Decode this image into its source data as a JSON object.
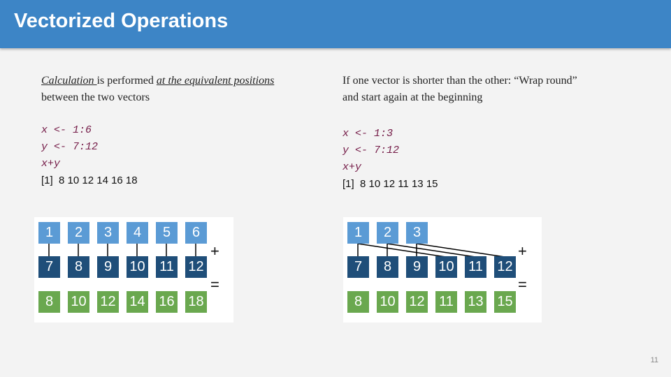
{
  "header": {
    "title": "Vectorized Operations"
  },
  "left": {
    "desc": {
      "u1": "Calculation ",
      "t1": "is performed  ",
      "u2": "at the equivalent positions",
      "t2": " between the two vectors"
    },
    "code": [
      "x <- 1:6",
      "y <- 7:12",
      "x+y"
    ],
    "output": "[1]  8 10 12 14 16 18",
    "diagram": {
      "top": [
        "1",
        "2",
        "3",
        "4",
        "5",
        "6"
      ],
      "mid": [
        "7",
        "8",
        "9",
        "10",
        "11",
        "12"
      ],
      "bottom": [
        "8",
        "10",
        "12",
        "14",
        "16",
        "18"
      ],
      "plus": "+",
      "equals": "="
    }
  },
  "right": {
    "desc": {
      "line1": "If one vector is shorter than the other: “Wrap round”",
      "line2": "and start again at the beginning"
    },
    "code": [
      "x <- 1:3",
      "y <- 7:12",
      "x+y"
    ],
    "output": "[1]  8 10 12 11 13 15",
    "diagram": {
      "top": [
        "1",
        "2",
        "3"
      ],
      "mid": [
        "7",
        "8",
        "9",
        "10",
        "11",
        "12"
      ],
      "bottom": [
        "8",
        "10",
        "12",
        "11",
        "13",
        "15"
      ],
      "plus": "+",
      "equals": "="
    }
  },
  "page_number": "11",
  "colors": {
    "header": "#3d85c6",
    "top_box": "#5b9bd5",
    "mid_box": "#1f4e79",
    "result_box": "#6aa84f",
    "code": "#741b47"
  }
}
